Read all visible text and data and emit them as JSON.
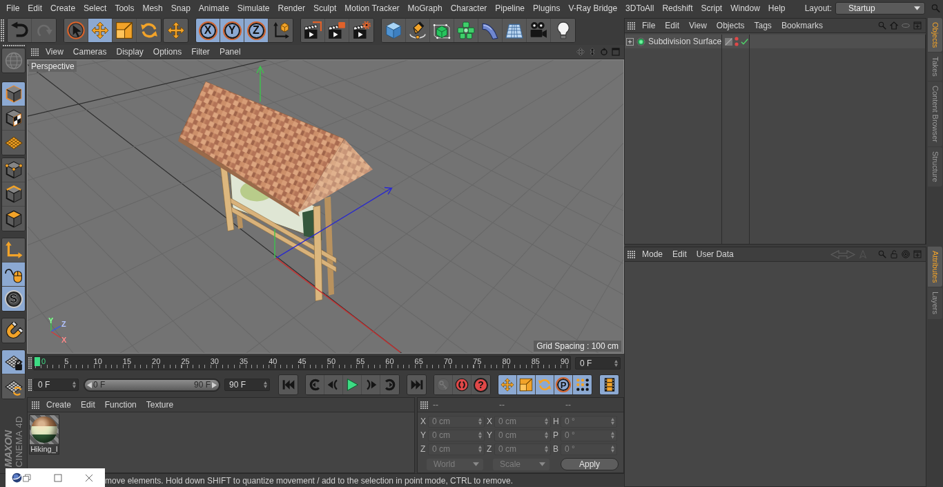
{
  "menu_bar": {
    "items": [
      "File",
      "Edit",
      "Create",
      "Select",
      "Tools",
      "Mesh",
      "Snap",
      "Animate",
      "Simulate",
      "Render",
      "Sculpt",
      "Motion Tracker",
      "MoGraph",
      "Character",
      "Pipeline",
      "Plugins",
      "V-Ray Bridge",
      "3DToAll",
      "Redshift",
      "Script",
      "Window",
      "Help"
    ],
    "layout_label": "Layout:",
    "layout_value": "Startup"
  },
  "toolbar": [
    {
      "items": [
        {
          "kind": "undo",
          "selected": false,
          "disabled": false
        },
        {
          "kind": "redo",
          "selected": false,
          "disabled": true
        }
      ]
    },
    {
      "items": [
        {
          "kind": "select",
          "selected": false,
          "disabled": false
        },
        {
          "kind": "move",
          "selected": true,
          "disabled": false
        },
        {
          "kind": "scale",
          "selected": false,
          "disabled": false
        },
        {
          "kind": "rotate",
          "selected": false,
          "disabled": false
        }
      ]
    },
    {
      "items": [
        {
          "kind": "move",
          "selected": false,
          "disabled": false
        }
      ]
    },
    {
      "items": [
        {
          "kind": "ring-letter",
          "label": "X",
          "selected": true,
          "disabled": false
        },
        {
          "kind": "ring-letter",
          "label": "Y",
          "selected": true,
          "disabled": false
        },
        {
          "kind": "ring-letter",
          "label": "Z",
          "selected": true,
          "disabled": false
        },
        {
          "kind": "coords",
          "selected": false,
          "disabled": false
        }
      ]
    },
    {
      "items": [
        {
          "kind": "render-view",
          "selected": false,
          "disabled": false
        },
        {
          "kind": "render-picture",
          "selected": false,
          "disabled": false
        },
        {
          "kind": "render-settings",
          "selected": false,
          "disabled": false
        }
      ]
    },
    {
      "items": [
        {
          "kind": "cube",
          "selected": false,
          "disabled": false
        },
        {
          "kind": "pen",
          "selected": false,
          "disabled": false
        },
        {
          "kind": "subdiv",
          "selected": false,
          "disabled": false
        },
        {
          "kind": "cloner",
          "selected": false,
          "disabled": false
        },
        {
          "kind": "bend",
          "selected": false,
          "disabled": false
        },
        {
          "kind": "floor",
          "selected": false,
          "disabled": false
        },
        {
          "kind": "camera",
          "selected": false,
          "disabled": false
        },
        {
          "kind": "light",
          "selected": false,
          "disabled": false
        }
      ]
    }
  ],
  "left_toolbar": [
    {
      "items": [
        {
          "kind": "globe",
          "selected": false,
          "disabled": true
        }
      ]
    },
    {
      "items": [
        {
          "kind": "model",
          "selected": true,
          "disabled": false
        },
        {
          "kind": "texture",
          "selected": false,
          "disabled": false
        },
        {
          "kind": "workplane",
          "selected": false,
          "disabled": false
        }
      ]
    },
    {
      "items": [
        {
          "kind": "points",
          "selected": false,
          "disabled": false
        },
        {
          "kind": "edges",
          "selected": false,
          "disabled": false
        },
        {
          "kind": "polygons",
          "selected": false,
          "disabled": false
        }
      ]
    },
    {
      "items": [
        {
          "kind": "axis",
          "selected": false,
          "disabled": false
        },
        {
          "kind": "tweak",
          "selected": true,
          "disabled": false
        },
        {
          "kind": "grey-letter",
          "label": "S",
          "selected": true,
          "disabled": false
        }
      ]
    },
    {
      "items": [
        {
          "kind": "magnet",
          "selected": false,
          "disabled": false
        }
      ]
    },
    {
      "items": [
        {
          "kind": "grid-lock",
          "selected": true,
          "disabled": false
        },
        {
          "kind": "grid-rotate",
          "selected": false,
          "disabled": false
        }
      ]
    }
  ],
  "logo": {
    "brand": "MAXON",
    "product": "CINEMA 4D"
  },
  "viewport": {
    "menu": [
      "View",
      "Cameras",
      "Display",
      "Options",
      "Filter",
      "Panel"
    ],
    "camera": "Perspective",
    "grid_spacing": "Grid Spacing : 100 cm",
    "axis_labels": [
      "Y",
      "Z",
      "X"
    ]
  },
  "timeline": {
    "ticks": [
      "0",
      "5",
      "10",
      "15",
      "20",
      "25",
      "30",
      "35",
      "40",
      "45",
      "50",
      "55",
      "60",
      "65",
      "70",
      "75",
      "80",
      "85",
      "90"
    ],
    "level": 0,
    "current_frame": "0 F"
  },
  "transport": {
    "start_frame": "0 F",
    "range_start": "0 F",
    "range_end": "90 F",
    "level": 1,
    "end_frame": "90 F",
    "groups": [
      {
        "items": [
          {
            "kind": "skip-start",
            "selected": false,
            "disabled": false
          }
        ]
      },
      {
        "items": [
          {
            "kind": "prev-key",
            "selected": false,
            "disabled": false
          },
          {
            "kind": "step-back",
            "selected": false,
            "disabled": false
          },
          {
            "kind": "play",
            "selected": false,
            "disabled": false
          },
          {
            "kind": "step-fwd",
            "selected": false,
            "disabled": false
          },
          {
            "kind": "next-key",
            "selected": false,
            "disabled": false
          }
        ]
      },
      {
        "items": [
          {
            "kind": "skip-end",
            "selected": false,
            "disabled": false
          }
        ]
      },
      {
        "items": [
          {
            "kind": "key",
            "selected": false,
            "disabled": true
          },
          {
            "kind": "record",
            "selected": false,
            "disabled": false
          },
          {
            "kind": "red-letter",
            "label": "?",
            "selected": false,
            "disabled": false
          }
        ]
      },
      {
        "items": [
          {
            "kind": "move",
            "selected": true,
            "disabled": false
          },
          {
            "kind": "scale",
            "selected": true,
            "disabled": false
          },
          {
            "kind": "rotate",
            "selected": true,
            "disabled": false
          },
          {
            "kind": "ring-letter",
            "label": "P",
            "selected": true,
            "disabled": false
          },
          {
            "kind": "dots",
            "selected": true,
            "disabled": false
          }
        ]
      },
      {
        "items": [
          {
            "kind": "film",
            "selected": true,
            "disabled": false
          }
        ]
      }
    ]
  },
  "material_manager": {
    "menu": [
      "Create",
      "Edit",
      "Function",
      "Texture"
    ],
    "materials": [
      {
        "name": "Hiking_I",
        "selected": false
      }
    ]
  },
  "coordinates": {
    "headers": [
      "--",
      "--",
      "--"
    ],
    "inputs_disabled": true,
    "rows": [
      {
        "cells": [
          {
            "axis": "X",
            "value": "0 cm"
          },
          {
            "axis": "X",
            "value": "0 cm"
          },
          {
            "axis": "H",
            "value": "0 °"
          }
        ]
      },
      {
        "cells": [
          {
            "axis": "Y",
            "value": "0 cm"
          },
          {
            "axis": "Y",
            "value": "0 cm"
          },
          {
            "axis": "P",
            "value": "0 °"
          }
        ]
      },
      {
        "cells": [
          {
            "axis": "Z",
            "value": "0 cm"
          },
          {
            "axis": "Z",
            "value": "0 cm"
          },
          {
            "axis": "B",
            "value": "0 °"
          }
        ]
      }
    ],
    "dropdowns": [
      "World",
      "Scale"
    ],
    "apply": "Apply"
  },
  "status_bar": {
    "text": "move elements. Hold down SHIFT to quantize movement / add to the selection in point mode, CTRL to remove."
  },
  "object_manager": {
    "menu": [
      "File",
      "Edit",
      "View",
      "Objects",
      "Tags",
      "Bookmarks"
    ],
    "objects": [
      {
        "name": "Subdivision Surface",
        "selected": false,
        "expanded": false,
        "visible": false,
        "enabled": true
      }
    ]
  },
  "attribute_manager": {
    "menu": [
      "Mode",
      "Edit",
      "User Data"
    ]
  },
  "side_tabs": {
    "upper": [
      {
        "label": "Objects",
        "selected": true
      },
      {
        "label": "Takes",
        "selected": false
      },
      {
        "label": "Content Browser",
        "selected": false
      },
      {
        "label": "Structure",
        "selected": false
      }
    ],
    "lower": [
      {
        "label": "Attributes",
        "selected": true
      },
      {
        "label": "Layers",
        "selected": false
      }
    ]
  }
}
